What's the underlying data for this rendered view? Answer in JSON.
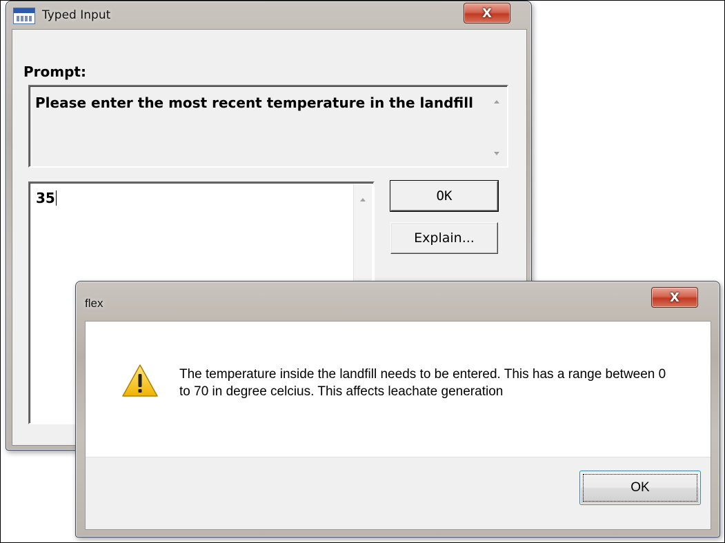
{
  "typed_input": {
    "title": "Typed Input",
    "close_glyph": "X",
    "prompt_label": "Prompt:",
    "prompt_text": "Please enter the most recent temperature in the landfill",
    "input_value": "35",
    "ok_label": "OK",
    "explain_label": "Explain..."
  },
  "message_box": {
    "title": "flex",
    "close_glyph": "X",
    "message": "The temperature inside the landfill needs to be entered. This has a range between 0 to 70 in degree celcius. This affects leachate generation",
    "icon": "warning-icon",
    "ok_label": "OK"
  },
  "colors": {
    "close_button_red": "#c13a22",
    "warning_yellow": "#f2c200",
    "client_gray": "#f0f0f0"
  }
}
